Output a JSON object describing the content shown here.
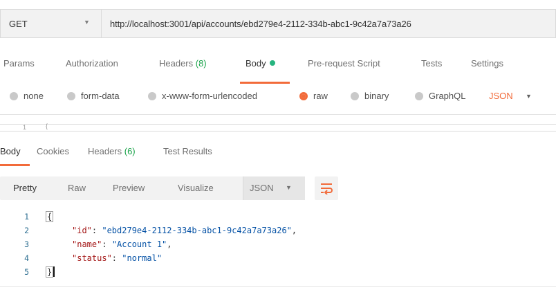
{
  "request": {
    "method": "GET",
    "url": "http://localhost:3001/api/accounts/ebd279e4-2112-334b-abc1-9c42a7a73a26"
  },
  "request_tabs": [
    {
      "label": "Params",
      "count": ""
    },
    {
      "label": "Authorization",
      "count": ""
    },
    {
      "label": "Headers ",
      "count": "(8)"
    },
    {
      "label": "Body",
      "count": ""
    },
    {
      "label": "Pre-request Script",
      "count": ""
    },
    {
      "label": "Tests",
      "count": ""
    },
    {
      "label": "Settings",
      "count": ""
    }
  ],
  "body_types": [
    "none",
    "form-data",
    "x-www-form-urlencoded",
    "raw",
    "binary",
    "GraphQL"
  ],
  "body_selected": "raw",
  "body_language": "JSON",
  "request_editor": {
    "line_number": "1",
    "first_char": "{"
  },
  "response_tabs": [
    {
      "label": "Body",
      "count": ""
    },
    {
      "label": "Cookies",
      "count": ""
    },
    {
      "label": "Headers ",
      "count": "(6)"
    },
    {
      "label": "Test Results",
      "count": ""
    }
  ],
  "view_modes": [
    "Pretty",
    "Raw",
    "Preview",
    "Visualize"
  ],
  "response_format": "JSON",
  "response_body": {
    "line_numbers": [
      "1",
      "2",
      "3",
      "4",
      "5"
    ],
    "open_brace": "{",
    "close_brace": "}",
    "fields": [
      {
        "key": "\"id\"",
        "value": "\"ebd279e4-2112-334b-abc1-9c42a7a73a26\"",
        "trail": ","
      },
      {
        "key": "\"name\"",
        "value": "\"Account 1\"",
        "trail": ","
      },
      {
        "key": "\"status\"",
        "value": "\"normal\"",
        "trail": ""
      }
    ]
  },
  "colors": {
    "accent": "#f26b3a",
    "count_green": "#1aa34a",
    "body_dot": "#26b47f",
    "json_key": "#a31515",
    "json_string": "#0451a5"
  },
  "icons": {
    "wrap": "wrap-lines-icon",
    "dropdown": "chevron-down-icon"
  }
}
